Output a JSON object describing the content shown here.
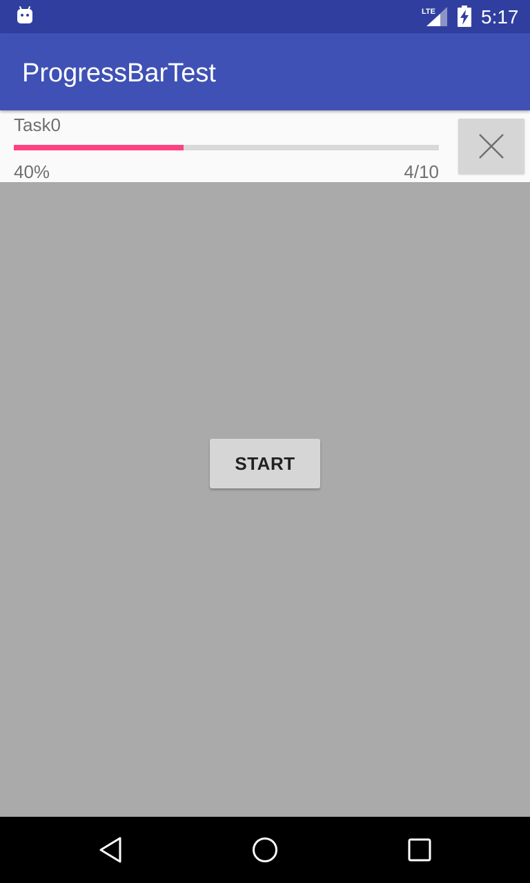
{
  "status_bar": {
    "time": "5:17",
    "network": "LTE",
    "icons": [
      "android-icon",
      "lte-signal-icon",
      "battery-charging-icon"
    ]
  },
  "app_bar": {
    "title": "ProgressBarTest"
  },
  "task": {
    "name": "Task0",
    "progress_fraction": 0.4,
    "percent_label": "40%",
    "count_label": "4/10",
    "cancel_icon": "close-icon"
  },
  "main": {
    "start_label": "START"
  },
  "nav_bar": {
    "icons": [
      "back-icon",
      "home-icon",
      "recents-icon"
    ]
  },
  "colors": {
    "status_bar": "#303f9f",
    "app_bar": "#3f51b5",
    "accent": "#ff4081",
    "background": "#aaaaaa"
  }
}
